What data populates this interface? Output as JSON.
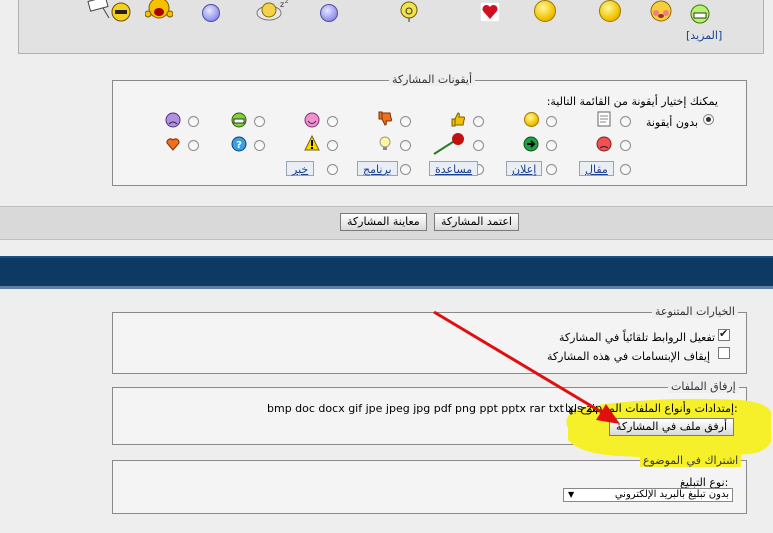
{
  "top_smilies": {
    "more_link": "[المزيد]"
  },
  "post_icons": {
    "legend": "أيقونات المشاركة",
    "prompt": "يمكنك إختيار أيقونة من القائمة التالية:",
    "no_icon_label": "بدون أيقونة",
    "tag_buttons": [
      "مقال",
      "إعلان",
      "مساعدة",
      "برنامج",
      "خبر"
    ]
  },
  "submit": {
    "submit_label": "اعتمد المشاركة",
    "preview_label": "معاينة المشاركة"
  },
  "misc_options": {
    "legend": "الخيارات المتنوعة",
    "parse_links_label": "تفعيل الروابط تلقائياً في المشاركة",
    "parse_links_checked": true,
    "disable_smilies_label": "إيقاف الإبتسامات في هذه المشاركة",
    "disable_smilies_checked": false
  },
  "attachments": {
    "legend": "إرفاق الملفات",
    "extensions_label": "إمتدادات وأنواع الملفات المسموح بها:",
    "extensions": "bmp doc docx gif jpe jpeg jpg pdf png ppt pptx rar txt xls zip",
    "attach_button": "أرفق ملف في المشاركة"
  },
  "subscription": {
    "legend": "اشتراك في الموضوع",
    "notify_label": "نوع التبليغ:",
    "notify_value": "بدون تبليغ بالبريد الإلكتروني"
  },
  "colors": {
    "blue_band": "#0d3a62",
    "highlight": "#f5f02a",
    "arrow": "#e01010",
    "link": "#1a3f8f"
  }
}
